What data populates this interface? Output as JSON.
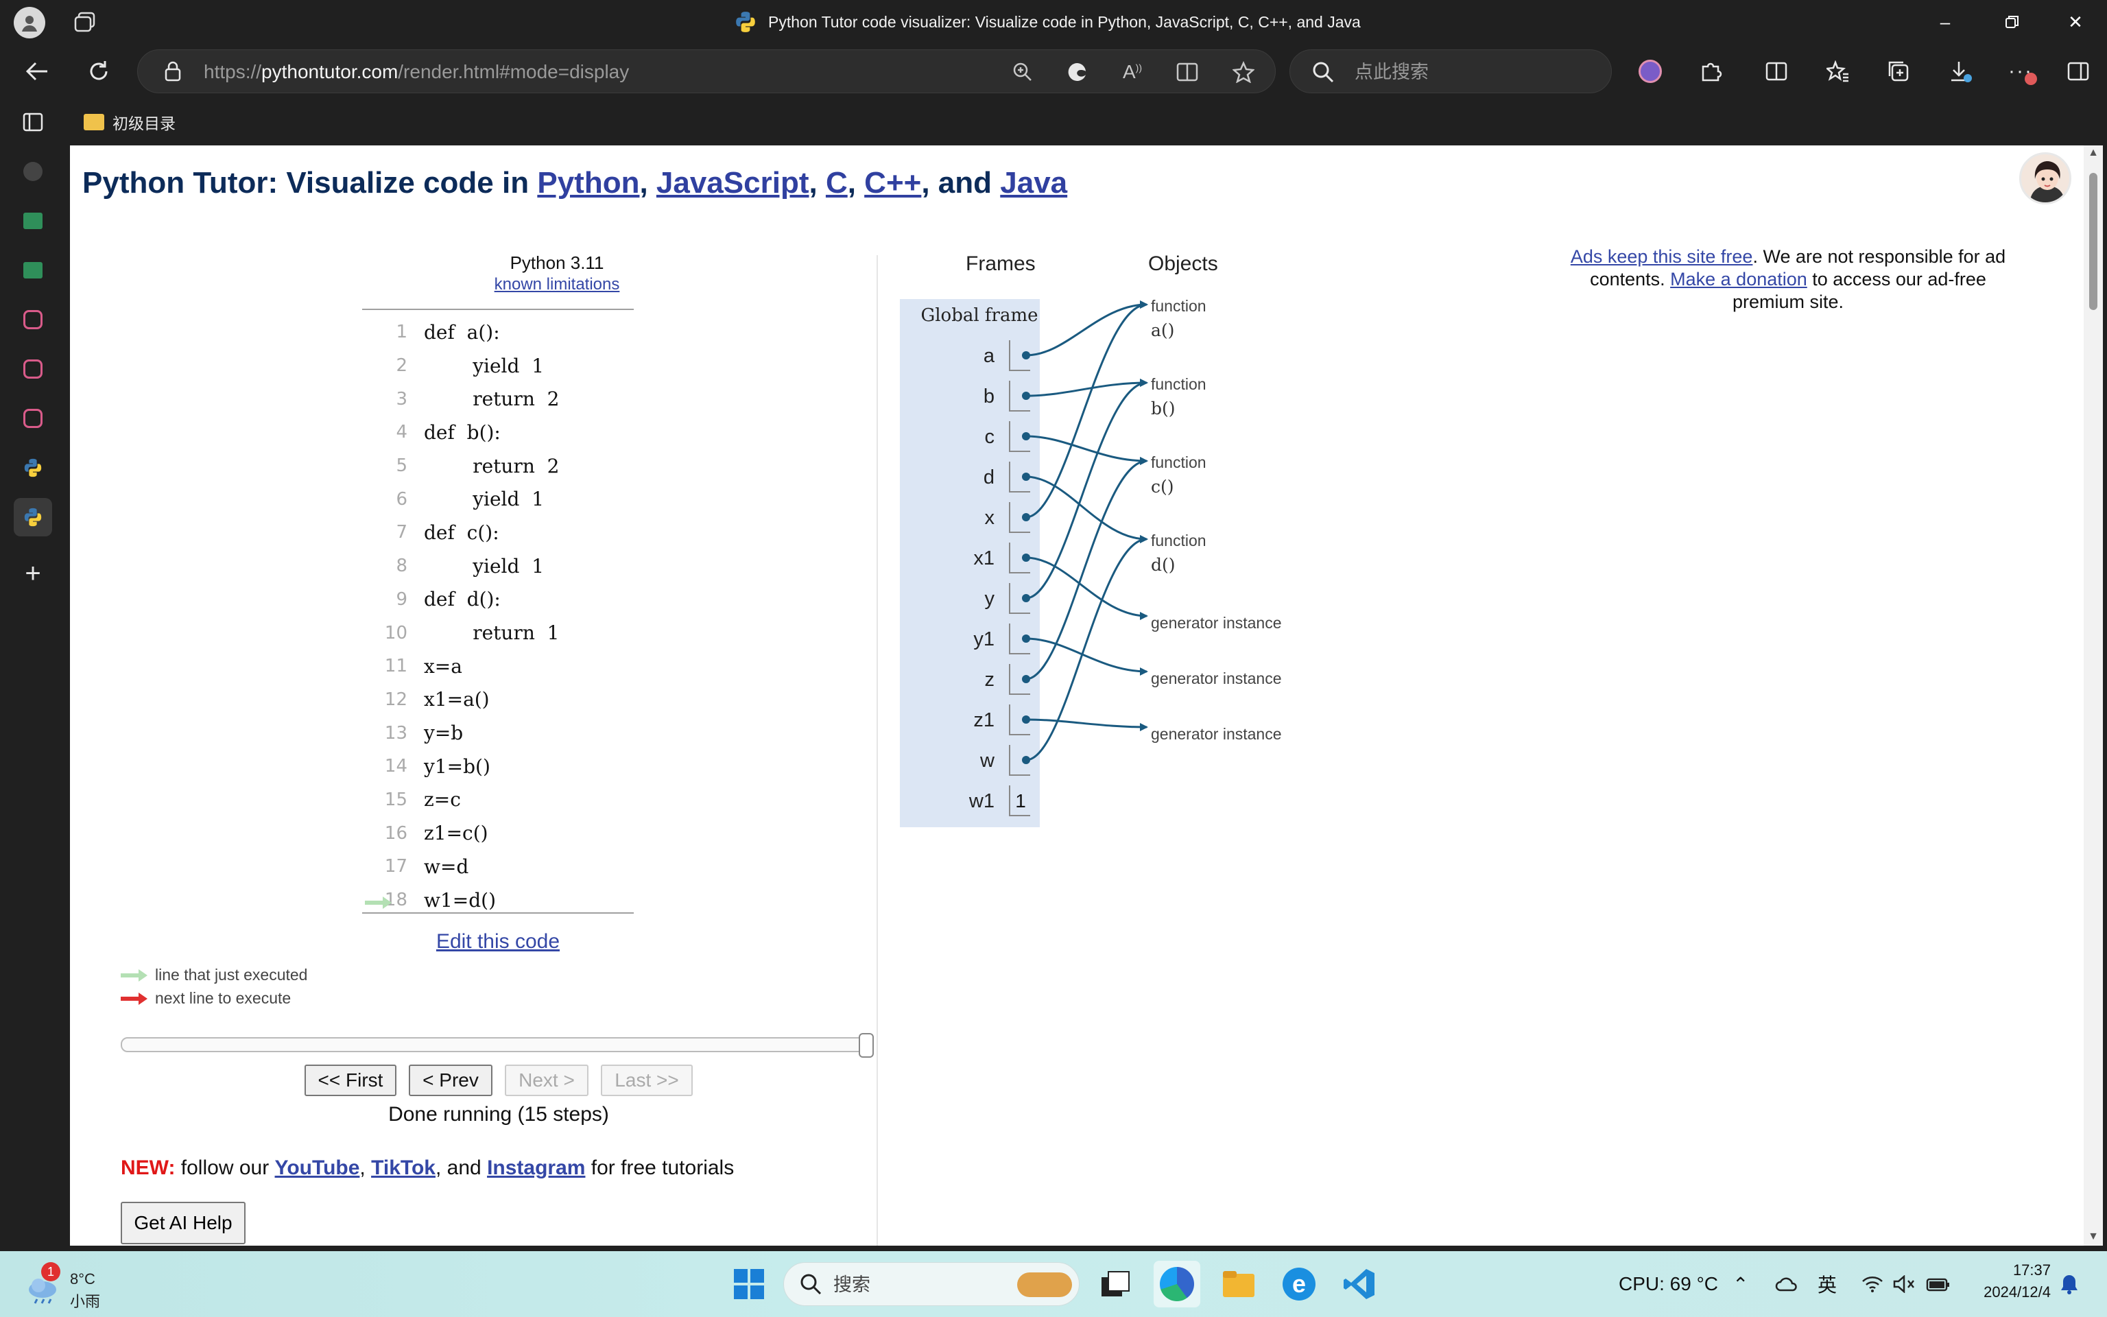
{
  "window": {
    "title": "Python Tutor code visualizer: Visualize code in Python, JavaScript, C, C++, and Java"
  },
  "address_bar": {
    "scheme": "https://",
    "host": "pythontutor.com",
    "path": "/render.html#mode=display"
  },
  "search_box": {
    "placeholder": "点此搜索"
  },
  "bookmarks": [
    {
      "label": "初级目录"
    }
  ],
  "page": {
    "heading_prefix": "Python Tutor: Visualize code in ",
    "heading_links": [
      "Python",
      "JavaScript",
      "C",
      "C++",
      "Java"
    ],
    "heading_sep1": ", ",
    "heading_and": ", and ",
    "language": "Python 3.11",
    "limitations_link": "known limitations",
    "code_lines": [
      {
        "n": "1",
        "src": "def  a():"
      },
      {
        "n": "2",
        "src": "        yield  1"
      },
      {
        "n": "3",
        "src": "        return  2"
      },
      {
        "n": "4",
        "src": "def  b():"
      },
      {
        "n": "5",
        "src": "        return  2"
      },
      {
        "n": "6",
        "src": "        yield  1"
      },
      {
        "n": "7",
        "src": "def  c():"
      },
      {
        "n": "8",
        "src": "        yield  1"
      },
      {
        "n": "9",
        "src": "def  d():"
      },
      {
        "n": "10",
        "src": "        return  1"
      },
      {
        "n": "11",
        "src": "x=a"
      },
      {
        "n": "12",
        "src": "x1=a()"
      },
      {
        "n": "13",
        "src": "y=b"
      },
      {
        "n": "14",
        "src": "y1=b()"
      },
      {
        "n": "15",
        "src": "z=c"
      },
      {
        "n": "16",
        "src": "z1=c()"
      },
      {
        "n": "17",
        "src": "w=d"
      },
      {
        "n": "18",
        "src": "w1=d()"
      }
    ],
    "current_line": 18,
    "edit_link": "Edit this code",
    "legend_executed": "line that just executed",
    "legend_next": "next line to execute",
    "step_progress": 1.0,
    "buttons": {
      "first": "<< First",
      "prev": "< Prev",
      "next": "Next >",
      "last": "Last >>"
    },
    "status": "Done running (15 steps)",
    "news_label": "NEW:",
    "news_text1": " follow our ",
    "news_links": [
      "YouTube",
      "TikTok",
      "Instagram"
    ],
    "news_sep": ", ",
    "news_and": ", and ",
    "news_text2": " for free tutorials",
    "ai_button": "Get AI Help",
    "ads_link1": "Ads keep this site free",
    "ads_text1": ". We are not responsible for ad contents. ",
    "ads_link2": "Make a donation",
    "ads_text2": " to access our ad-free premium site.",
    "colors": {
      "heading": "#0c2b59",
      "link": "#3447a6",
      "frame_bg": "#dce6f4",
      "arrow": "#1a5a80",
      "executed_arrow": "#b4e0b4",
      "next_arrow": "#e03030"
    }
  },
  "visualizer": {
    "frames_label": "Frames",
    "objects_label": "Objects",
    "frame_title": "Global frame",
    "variables": [
      {
        "name": "a",
        "ref": "fa"
      },
      {
        "name": "b",
        "ref": "fb"
      },
      {
        "name": "c",
        "ref": "fc"
      },
      {
        "name": "d",
        "ref": "fd"
      },
      {
        "name": "x",
        "ref": "fa"
      },
      {
        "name": "x1",
        "ref": "g1"
      },
      {
        "name": "y",
        "ref": "fb"
      },
      {
        "name": "y1",
        "ref": "g2"
      },
      {
        "name": "z",
        "ref": "fc"
      },
      {
        "name": "z1",
        "ref": "g3"
      },
      {
        "name": "w",
        "ref": "fd"
      },
      {
        "name": "w1",
        "value": "1"
      }
    ],
    "objects": [
      {
        "id": "fa",
        "kind": "function",
        "name": "a()"
      },
      {
        "id": "fb",
        "kind": "function",
        "name": "b()"
      },
      {
        "id": "fc",
        "kind": "function",
        "name": "c()"
      },
      {
        "id": "fd",
        "kind": "function",
        "name": "d()"
      },
      {
        "id": "g1",
        "kind": "generator instance",
        "name": ""
      },
      {
        "id": "g2",
        "kind": "generator instance",
        "name": ""
      },
      {
        "id": "g3",
        "kind": "generator instance",
        "name": ""
      }
    ]
  },
  "taskbar": {
    "weather_temp": "8°C",
    "weather_desc": "小雨",
    "weather_badge": "1",
    "search_label": "搜索",
    "cpu": "CPU: 69 °C",
    "ime": "英",
    "time": "17:37",
    "date": "2024/12/4"
  }
}
